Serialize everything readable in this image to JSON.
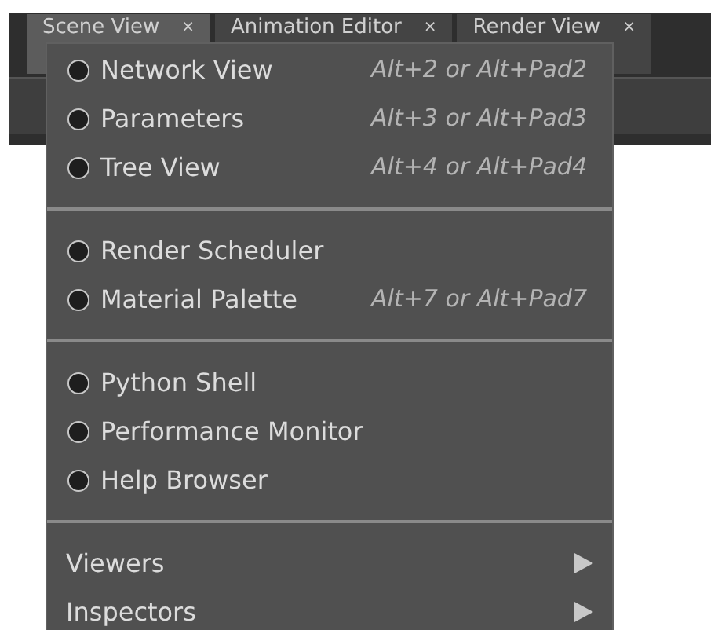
{
  "tabs": [
    {
      "label": "Scene View",
      "close": "×",
      "selected": true
    },
    {
      "label": "Animation Editor",
      "close": "×",
      "selected": false
    },
    {
      "label": "Render View",
      "close": "×",
      "selected": false
    }
  ],
  "menu": {
    "groups": [
      {
        "items": [
          {
            "kind": "radio",
            "label": "Network View",
            "shortcut": "Alt+2 or Alt+Pad2"
          },
          {
            "kind": "radio",
            "label": "Parameters",
            "shortcut": "Alt+3 or Alt+Pad3"
          },
          {
            "kind": "radio",
            "label": "Tree View",
            "shortcut": "Alt+4 or Alt+Pad4"
          }
        ]
      },
      {
        "items": [
          {
            "kind": "radio",
            "label": "Render Scheduler"
          },
          {
            "kind": "radio",
            "label": "Material Palette",
            "shortcut": "Alt+7 or Alt+Pad7"
          }
        ]
      },
      {
        "items": [
          {
            "kind": "radio",
            "label": "Python Shell"
          },
          {
            "kind": "radio",
            "label": "Performance Monitor"
          },
          {
            "kind": "radio",
            "label": "Help Browser"
          }
        ]
      },
      {
        "items": [
          {
            "kind": "submenu",
            "label": "Viewers"
          },
          {
            "kind": "submenu",
            "label": "Inspectors"
          }
        ]
      }
    ]
  }
}
